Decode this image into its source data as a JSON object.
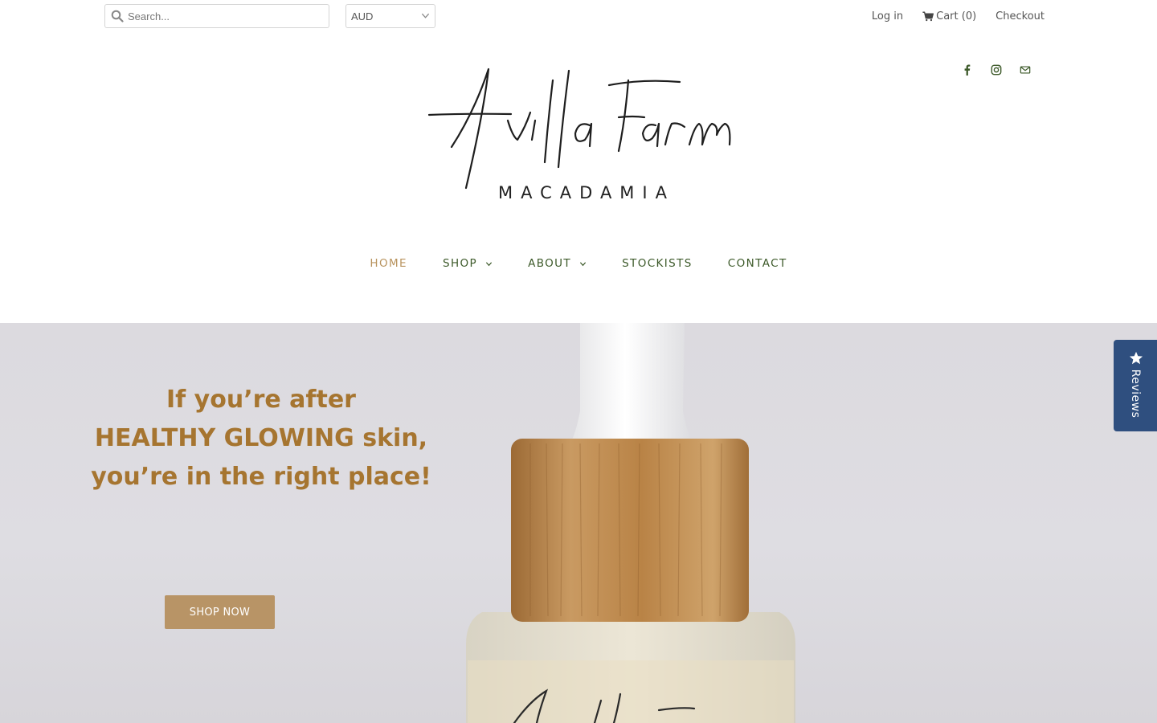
{
  "header": {
    "search": {
      "placeholder": "Search...",
      "value": ""
    },
    "currency": {
      "selected": "AUD"
    },
    "links": {
      "login": "Log in",
      "cart": "Cart (0)",
      "checkout": "Checkout"
    }
  },
  "social": {
    "icons": [
      "facebook-icon",
      "instagram-icon",
      "mail-icon"
    ],
    "color": "#3d5a2a"
  },
  "brand": {
    "script_name": "Avilla Farm",
    "tagline": "MACADAMIA"
  },
  "nav": {
    "items": [
      {
        "label": "HOME",
        "active": true
      },
      {
        "label": "SHOP",
        "dropdown": true
      },
      {
        "label": "ABOUT",
        "dropdown": true
      },
      {
        "label": "STOCKISTS"
      },
      {
        "label": "CONTACT"
      }
    ],
    "colors": {
      "default": "#3d5a2a",
      "active": "#b8935e"
    }
  },
  "hero": {
    "heading_lines": [
      "If you’re after",
      "HEALTHY GLOWING skin,",
      "you’re in the right place!"
    ],
    "cta_label": "SHOP NOW",
    "colors": {
      "heading": "#a67530",
      "cta_bg": "#b89466"
    }
  },
  "reviews_tab": {
    "label": "Reviews",
    "color": "#2f4f7f"
  }
}
